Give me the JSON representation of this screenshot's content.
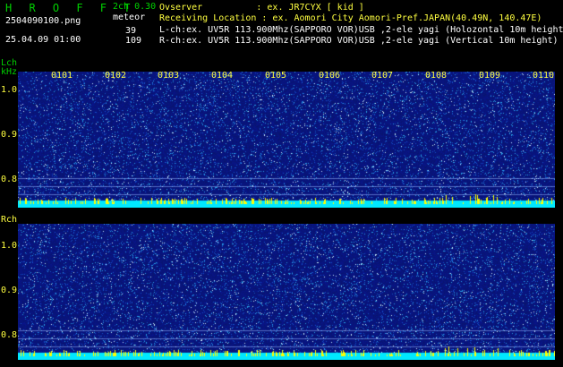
{
  "header": {
    "app_title": "H R O F F T",
    "version": "2ch 0.30",
    "mode": "meteor",
    "filename": "2504090100.png",
    "datetime": "25.04.09 01:00",
    "count_l": "39",
    "count_r": "109"
  },
  "info": {
    "observer": "Ovserver          : ex. JR7CYX [ kid ]",
    "location": "Receiving Location : ex. Aomori City Aomori-Pref.JAPAN(40.49N, 140.47E)",
    "lch": "L-ch:ex. UV5R 113.900Mhz(SAPPORO VOR)USB ,2-ele yagi (Holozontal 10m height)",
    "rch": "R-ch:ex. UV5R 113.900Mhz(SAPPORO VOR)USB ,2-ele yagi (Vertical 10m height)"
  },
  "channels": {
    "lch_label": "Lch",
    "lch_unit": "kHz",
    "rch_label": "Rch"
  },
  "y_ticks": [
    "1.0",
    "0.9",
    "0.8"
  ],
  "time_labels": [
    "0101",
    "0102",
    "0103",
    "0104",
    "0105",
    "0106",
    "0107",
    "0108",
    "0109",
    "0110"
  ],
  "colors": {
    "background": "#000000",
    "spectrogram_base": "#0a1a78",
    "noise_band": "#00e8ff",
    "meteor_spike": "#ffff00",
    "text_green": "#00d000",
    "text_yellow": "#ffff40",
    "text_white": "#ffffff"
  }
}
